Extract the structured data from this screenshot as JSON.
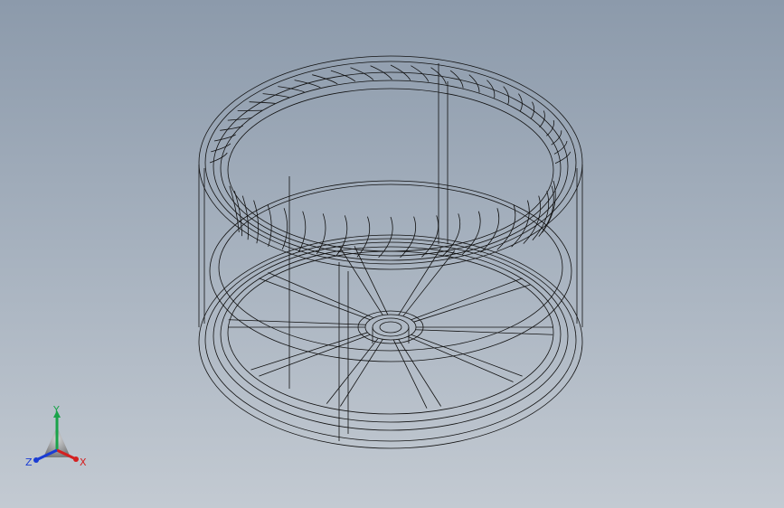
{
  "triad": {
    "x_label": "X",
    "y_label": "Y",
    "z_label": "Z"
  },
  "colors": {
    "background_top": "#8c9aab",
    "background_bottom": "#c3cad2",
    "wireframe": "#111111",
    "axis_x": "#d42020",
    "axis_y": "#1aa34a",
    "axis_z": "#1a3cd4"
  },
  "icons": {
    "triad": "view-orientation-triad-icon"
  }
}
